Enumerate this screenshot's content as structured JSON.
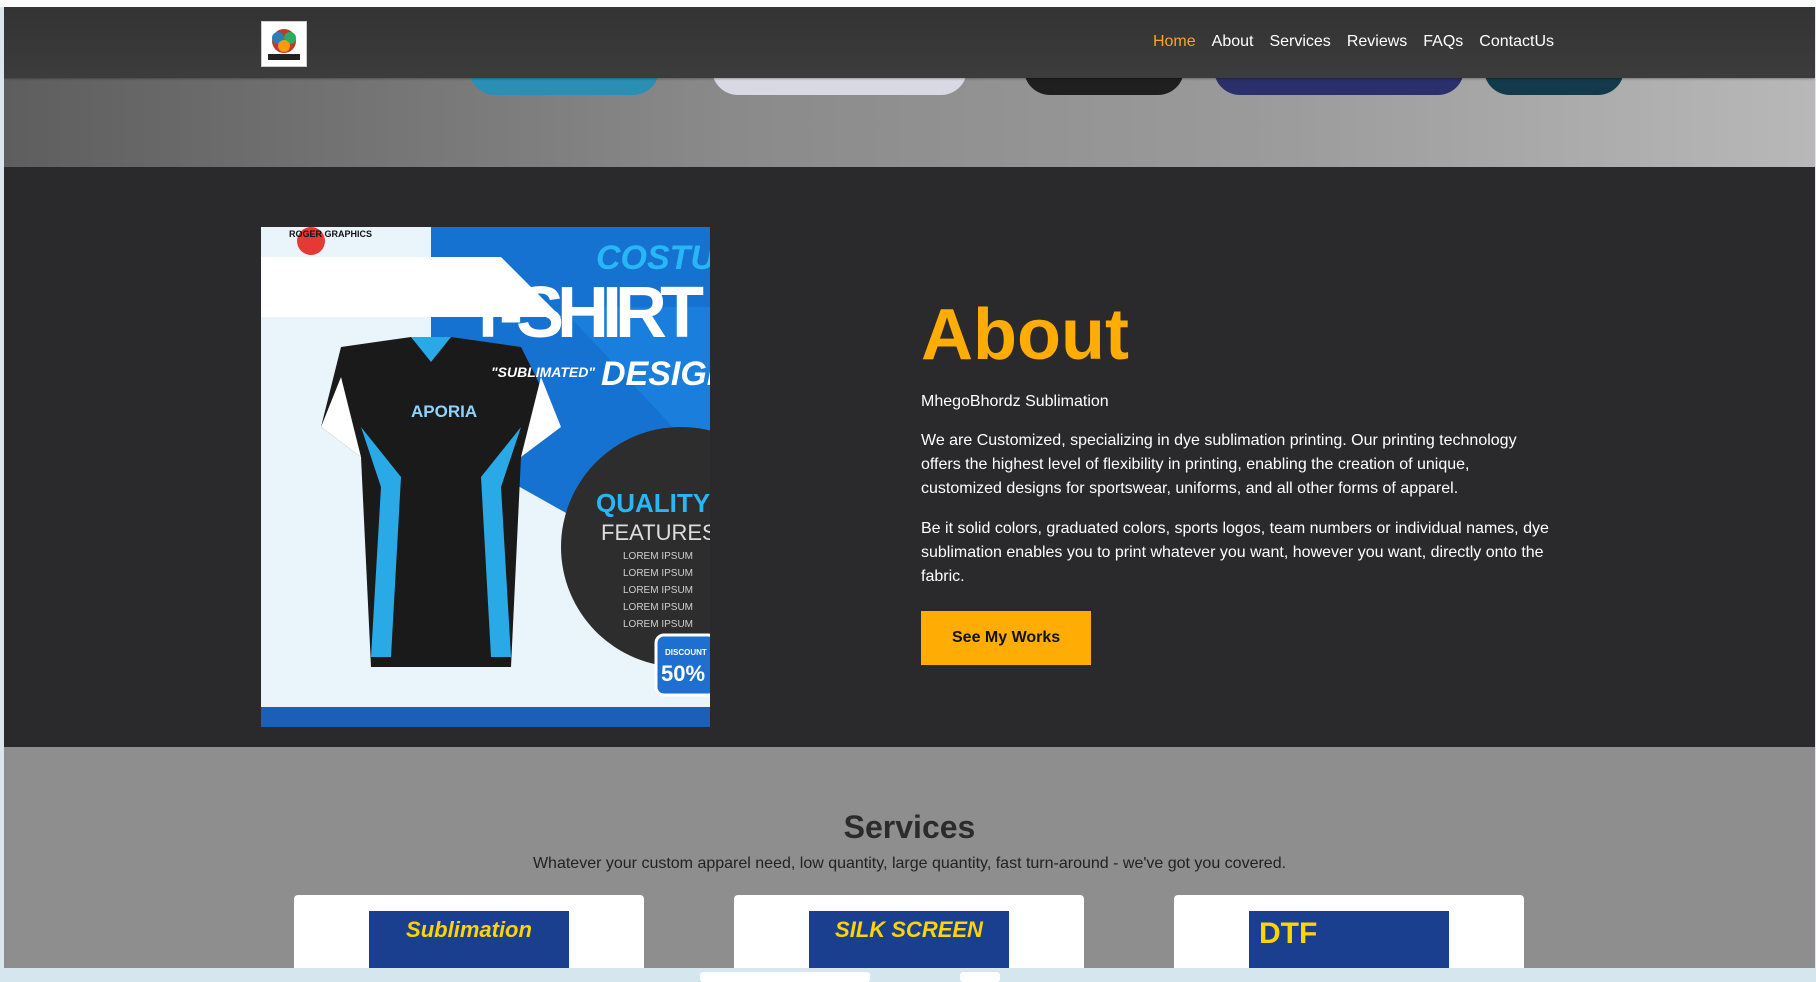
{
  "nav": {
    "items": [
      {
        "label": "Home",
        "active": true
      },
      {
        "label": "About",
        "active": false
      },
      {
        "label": "Services",
        "active": false
      },
      {
        "label": "Reviews",
        "active": false
      },
      {
        "label": "FAQs",
        "active": false
      },
      {
        "label": "ContactUs",
        "active": false
      }
    ]
  },
  "about": {
    "title": "About",
    "subtitle": "MhegoBhordz Sublimation",
    "paragraphs": [
      "We are Customized, specializing in dye sublimation printing. Our printing technology offers the highest level of flexibility in printing, enabling the creation of unique, customized designs for sportswear, uniforms, and all other forms of apparel.",
      "Be it solid colors, graduated colors, sports logos, team numbers or individual names, dye sublimation enables you to print whatever you want, however you want, directly onto the fabric."
    ],
    "button_label": "See My Works",
    "image": {
      "brand": "ROGER GRAPHICS",
      "headline_top": "COSTUM",
      "headline_main": "T-SHIRT",
      "headline_sub": "\"SUBLIMATED\"",
      "headline_design": "DESIGN",
      "jersey_logo": "APORIA",
      "features_title": "QUALITY",
      "features_sub": "FEATURES",
      "features": [
        "LOREM IPSUM",
        "LOREM IPSUM",
        "LOREM IPSUM",
        "LOREM IPSUM",
        "LOREM IPSUM"
      ],
      "discount_label": "DISCOUNT",
      "discount_value": "50%"
    }
  },
  "services": {
    "title": "Services",
    "description": "Whatever your custom apparel need, low quantity, large quantity, fast turn-around - we've got you covered.",
    "cards": [
      {
        "label": "Sublimation"
      },
      {
        "label": "SILK SCREEN"
      },
      {
        "label": "DTF"
      }
    ]
  },
  "colors": {
    "accent": "#ffad05",
    "nav_bg": "#363636",
    "about_bg": "#2a292c",
    "services_bg": "#8e8e8e"
  }
}
